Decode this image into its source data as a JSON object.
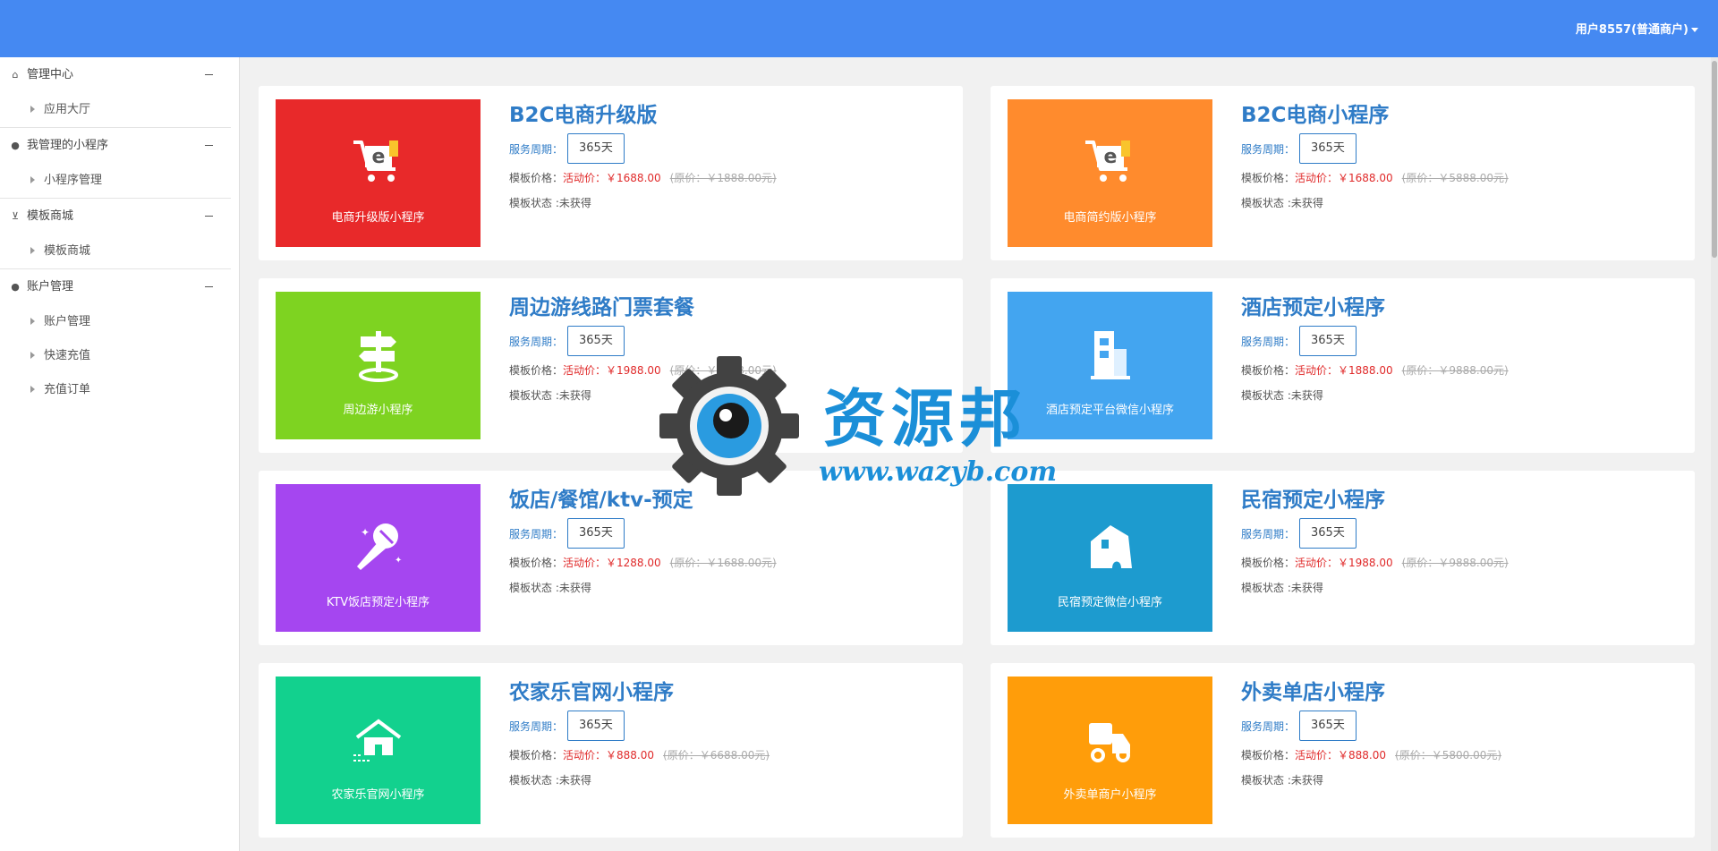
{
  "header": {
    "user_label": "用户8557(普通商户)"
  },
  "sidebar": {
    "groups": [
      {
        "label": "管理中心",
        "icon": "home-icon",
        "items": [
          {
            "label": "应用大厅"
          }
        ]
      },
      {
        "label": "我管理的小程序",
        "icon": "wechat-icon",
        "items": [
          {
            "label": "小程序管理"
          }
        ]
      },
      {
        "label": "模板商城",
        "icon": "cart-icon",
        "items": [
          {
            "label": "模板商城"
          }
        ]
      },
      {
        "label": "账户管理",
        "icon": "user-icon",
        "items": [
          {
            "label": "账户管理"
          },
          {
            "label": "快速充值"
          },
          {
            "label": "充值订单"
          }
        ]
      }
    ]
  },
  "labels": {
    "period": "服务周期：",
    "price": "模板价格：",
    "activity": "活动价：",
    "status_prefix": "模板状态 :"
  },
  "products": [
    {
      "title": "B2C电商升级版",
      "thumb_label": "电商升级版小程序",
      "thumb_color": "#e8292a",
      "icon": "shopping-cart-icon",
      "period": "365天",
      "price": "￥1688.00",
      "original": "(原价：￥1888.00元)",
      "status": "未获得"
    },
    {
      "title": "B2C电商小程序",
      "thumb_label": "电商简约版小程序",
      "thumb_color": "#ff8b2d",
      "icon": "shopping-cart-icon",
      "period": "365天",
      "price": "￥1688.00",
      "original": "(原价：￥5888.00元)",
      "status": "未获得"
    },
    {
      "title": "周边游线路门票套餐",
      "thumb_label": "周边游小程序",
      "thumb_color": "#7ed321",
      "icon": "signpost-icon",
      "period": "365天",
      "price": "￥1988.00",
      "original": "(原价：￥2888.00元)",
      "status": "未获得"
    },
    {
      "title": "酒店预定小程序",
      "thumb_label": "酒店预定平台微信小程序",
      "thumb_color": "#43a5f0",
      "icon": "hotel-icon",
      "period": "365天",
      "price": "￥1888.00",
      "original": "(原价：￥9888.00元)",
      "status": "未获得"
    },
    {
      "title": "饭店/餐馆/ktv-预定",
      "thumb_label": "KTV饭店预定小程序",
      "thumb_color": "#a546f0",
      "icon": "microphone-icon",
      "period": "365天",
      "price": "￥1288.00",
      "original": "(原价：￥1688.00元)",
      "status": "未获得"
    },
    {
      "title": "民宿预定小程序",
      "thumb_label": "民宿预定微信小程序",
      "thumb_color": "#1d9bcf",
      "icon": "guesthouse-icon",
      "period": "365天",
      "price": "￥1988.00",
      "original": "(原价：￥9888.00元)",
      "status": "未获得"
    },
    {
      "title": "农家乐官网小程序",
      "thumb_label": "农家乐官网小程序",
      "thumb_color": "#12d18e",
      "icon": "farmhouse-icon",
      "period": "365天",
      "price": "￥888.00",
      "original": "(原价：￥6688.00元)",
      "status": "未获得"
    },
    {
      "title": "外卖单店小程序",
      "thumb_label": "外卖单商户小程序",
      "thumb_color": "#ff9d0a",
      "icon": "delivery-icon",
      "period": "365天",
      "price": "￥888.00",
      "original": "(原价：￥5800.00元)",
      "status": "未获得"
    }
  ],
  "watermark": {
    "name": "资源邦",
    "url": "www.wazyb.com"
  }
}
